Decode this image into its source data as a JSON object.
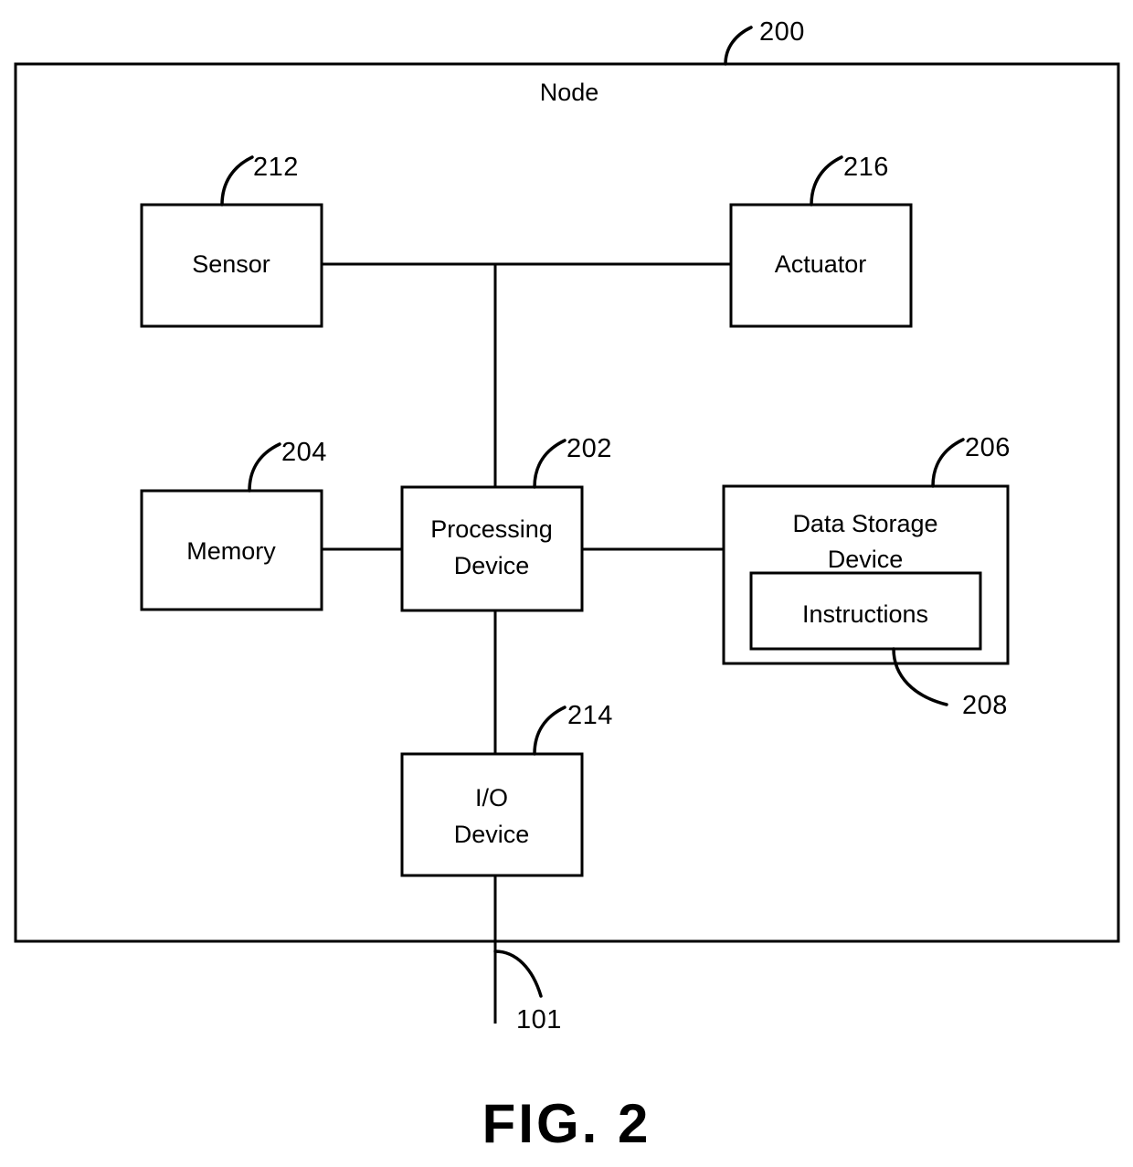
{
  "figure": {
    "caption": "FIG. 2",
    "outer_ref": "200",
    "outer_label": "Node",
    "bus_ref": "101"
  },
  "blocks": [
    {
      "id": "sensor",
      "label": "Sensor",
      "ref": "212"
    },
    {
      "id": "actuator",
      "label": "Actuator",
      "ref": "216"
    },
    {
      "id": "memory",
      "label": "Memory",
      "ref": "204"
    },
    {
      "id": "processing_device",
      "label_line1": "Processing",
      "label_line2": "Device",
      "ref": "202"
    },
    {
      "id": "data_storage",
      "label_line1": "Data Storage",
      "label_line2": "Device",
      "ref": "206"
    },
    {
      "id": "instructions",
      "label": "Instructions",
      "ref": "208"
    },
    {
      "id": "io_device",
      "label_line1": "I/O",
      "label_line2": "Device",
      "ref": "214"
    }
  ],
  "sensor": {
    "label": "Sensor",
    "ref": "212"
  },
  "actuator": {
    "label": "Actuator",
    "ref": "216"
  },
  "memory": {
    "label": "Memory",
    "ref": "204"
  },
  "processing": {
    "line1": "Processing",
    "line2": "Device",
    "ref": "202"
  },
  "storage": {
    "line1": "Data Storage",
    "line2": "Device",
    "ref": "206"
  },
  "instructions": {
    "label": "Instructions",
    "ref": "208"
  },
  "io": {
    "line1": "I/O",
    "line2": "Device",
    "ref": "214"
  },
  "colors": {
    "stroke": "#000000",
    "background": "#ffffff"
  }
}
